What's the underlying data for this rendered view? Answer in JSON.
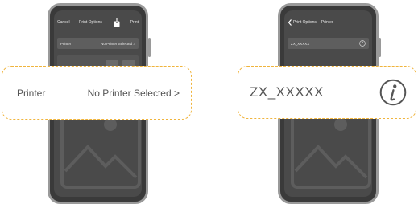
{
  "left_screen": {
    "nav": {
      "cancel_label": "Cancel",
      "title": "Print Options",
      "share_icon": "share-icon",
      "print_label": "Print"
    },
    "printer_row": {
      "label": "Printer",
      "value": "No Printer Selected >"
    }
  },
  "left_callout": {
    "label": "Printer",
    "value": "No Printer Selected >"
  },
  "right_screen": {
    "nav": {
      "back_label": "Print Options",
      "title": "Printer"
    },
    "printer_item": {
      "name": "ZX_XXXXX",
      "info_icon": "info-icon"
    }
  },
  "right_callout": {
    "name": "ZX_XXXXX",
    "info_icon": "info-icon"
  },
  "colors": {
    "accent_outline": "#f0b43c",
    "phone_body": "#3a3a3a",
    "phone_frame": "#9a9a9a",
    "text_dark": "#555555"
  }
}
